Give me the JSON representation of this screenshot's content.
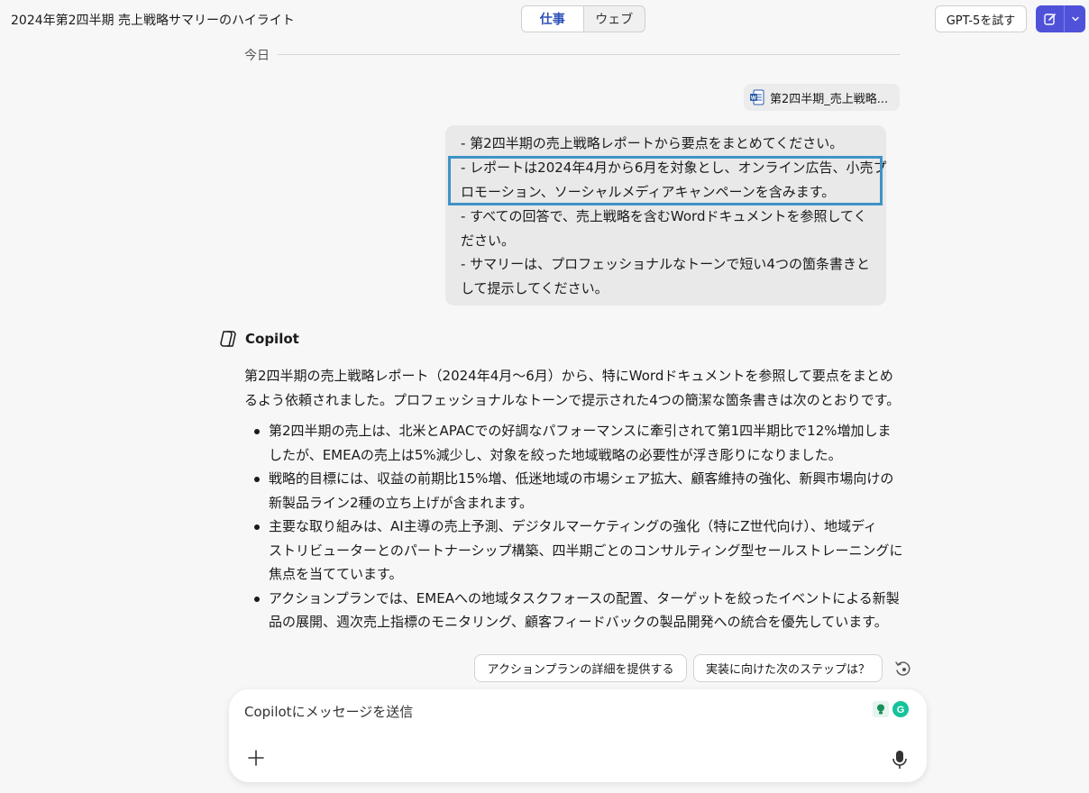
{
  "header": {
    "title": "2024年第2四半期 売上戦略サマリーのハイライト",
    "tabs": [
      "仕事",
      "ウェブ"
    ],
    "active_tab": "仕事",
    "try_gpt": "GPT-5を試す"
  },
  "date_label": "今日",
  "attachment": {
    "name": "第2四半期_売上戦略..."
  },
  "user_message": {
    "lines": [
      "- 第2四半期の売上戦略レポートから要点をまとめてください。",
      "- レポートは2024年4月から6月を対象とし、オンライン広告、小売プ",
      "ロモーション、ソーシャルメディアキャンペーンを含みます。",
      "- すべての回答で、売上戦略を含むWordドキュメントを参照してく",
      "ださい。",
      "- サマリーは、プロフェッショナルなトーンで短い4つの箇条書きと",
      "して提示してください。"
    ]
  },
  "copilot": {
    "name": "Copilot",
    "intro_lines": [
      "第2四半期の売上戦略レポート（2024年4月～6月）から、特にWordドキュメントを参照して要点をまとめ",
      "るよう依頼されました。プロフェッショナルなトーンで提示された4つの簡潔な箇条書きは次のとおりです。"
    ],
    "bullets": [
      [
        "第2四半期の売上は、北米とAPACでの好調なパフォーマンスに牽引されて第1四半期比で12%増加しま",
        "したが、EMEAの売上は5%減少し、対象を絞った地域戦略の必要性が浮き彫りになりました。"
      ],
      [
        "戦略的目標には、収益の前期比15%増、低迷地域の市場シェア拡大、顧客維持の強化、新興市場向けの",
        "新製品ライン2種の立ち上げが含まれます。"
      ],
      [
        "主要な取り組みは、AI主導の売上予測、デジタルマーケティングの強化（特にZ世代向け）、地域ディ",
        "ストリビューターとのパートナーシップ構築、四半期ごとのコンサルティング型セールストレーニングに",
        "焦点を当てています。"
      ],
      [
        "アクションプランでは、EMEAへの地域タスクフォースの配置、ターゲットを絞ったイベントによる新製",
        "品の展開、週次売上指標のモニタリング、顧客フィードバックの製品開発への統合を優先しています。"
      ]
    ]
  },
  "suggestions": [
    "アクションプランの詳細を提供する",
    "実装に向けた次のステップは？"
  ],
  "composer": {
    "placeholder": "Copilotにメッセージを送信"
  },
  "colors": {
    "accent": "#4f52d9",
    "highlight": "#3e93c6",
    "active_tab_text": "#2b4fb8"
  }
}
